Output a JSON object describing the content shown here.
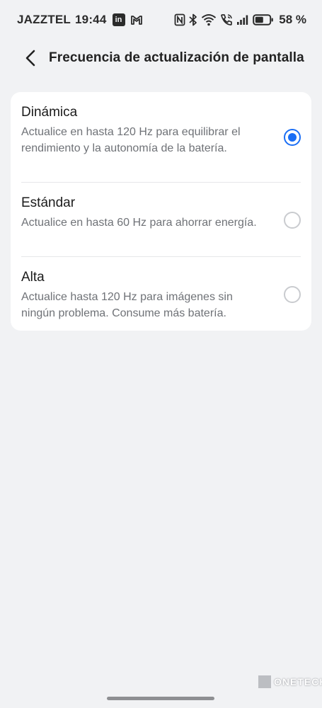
{
  "status_bar": {
    "carrier": "JAZZTEL",
    "time": "19:44",
    "notification_icons": [
      "linkedin-icon",
      "gmail-icon"
    ],
    "linkedin_label": "in",
    "system_icons": [
      "nfc-icon",
      "bluetooth-icon",
      "wifi-calling-icon",
      "volte-call-icon",
      "signal-icon",
      "battery-icon"
    ],
    "battery_percent": "58 %",
    "battery_level": 0.58
  },
  "header": {
    "back_icon": "chevron-left-icon",
    "title": "Frecuencia de actualización de pantalla"
  },
  "options": [
    {
      "title": "Dinámica",
      "description": "Actualice en hasta 120 Hz para equilibrar el rendimiento y la autonomía de la batería.",
      "selected": true
    },
    {
      "title": "Estándar",
      "description": "Actualice en hasta 60 Hz para ahorrar energía.",
      "selected": false
    },
    {
      "title": "Alta",
      "description": "Actualice hasta 120 Hz para imágenes sin ningún problema. Consume más batería.",
      "selected": false
    }
  ],
  "colors": {
    "accent": "#1a6ef5",
    "background": "#f1f2f4",
    "card": "#ffffff",
    "secondary_text": "#6f7277"
  },
  "watermark": {
    "text": "ONETECH"
  }
}
